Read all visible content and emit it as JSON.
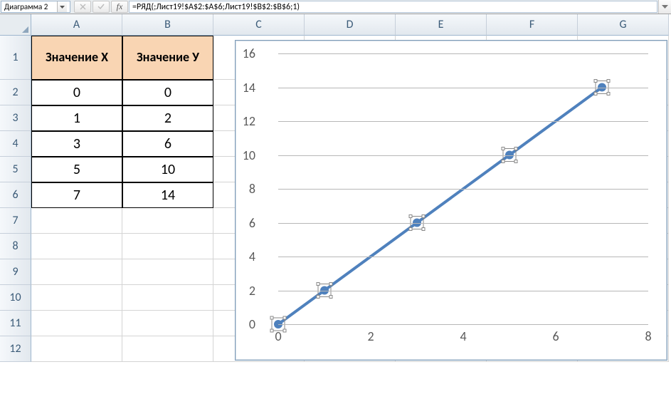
{
  "formula_bar": {
    "name_box": "Диаграмма 2",
    "formula": "=РЯД(;Лист19!$A$2:$A$6;Лист19!$B$2:$B$6;1)",
    "fx_label": "fx"
  },
  "columns": [
    "A",
    "B",
    "C",
    "D",
    "E",
    "F",
    "G"
  ],
  "rows": [
    "1",
    "2",
    "3",
    "4",
    "5",
    "6",
    "7",
    "8",
    "9",
    "10",
    "11",
    "12"
  ],
  "table": {
    "header_x": "Значение Х",
    "header_y": "Значение У",
    "rows": [
      {
        "x": "0",
        "y": "0"
      },
      {
        "x": "1",
        "y": "2"
      },
      {
        "x": "3",
        "y": "6"
      },
      {
        "x": "5",
        "y": "10"
      },
      {
        "x": "7",
        "y": "14"
      }
    ]
  },
  "chart_data": {
    "type": "scatter",
    "x": [
      0,
      1,
      3,
      5,
      7
    ],
    "y": [
      0,
      2,
      6,
      10,
      14
    ],
    "xlim": [
      0,
      8
    ],
    "ylim": [
      0,
      16
    ],
    "xticks": [
      0,
      2,
      4,
      6,
      8
    ],
    "yticks": [
      0,
      2,
      4,
      6,
      8,
      10,
      12,
      14,
      16
    ],
    "grid": "horizontal",
    "line": true,
    "xlabel": "",
    "ylabel": "",
    "title": ""
  }
}
